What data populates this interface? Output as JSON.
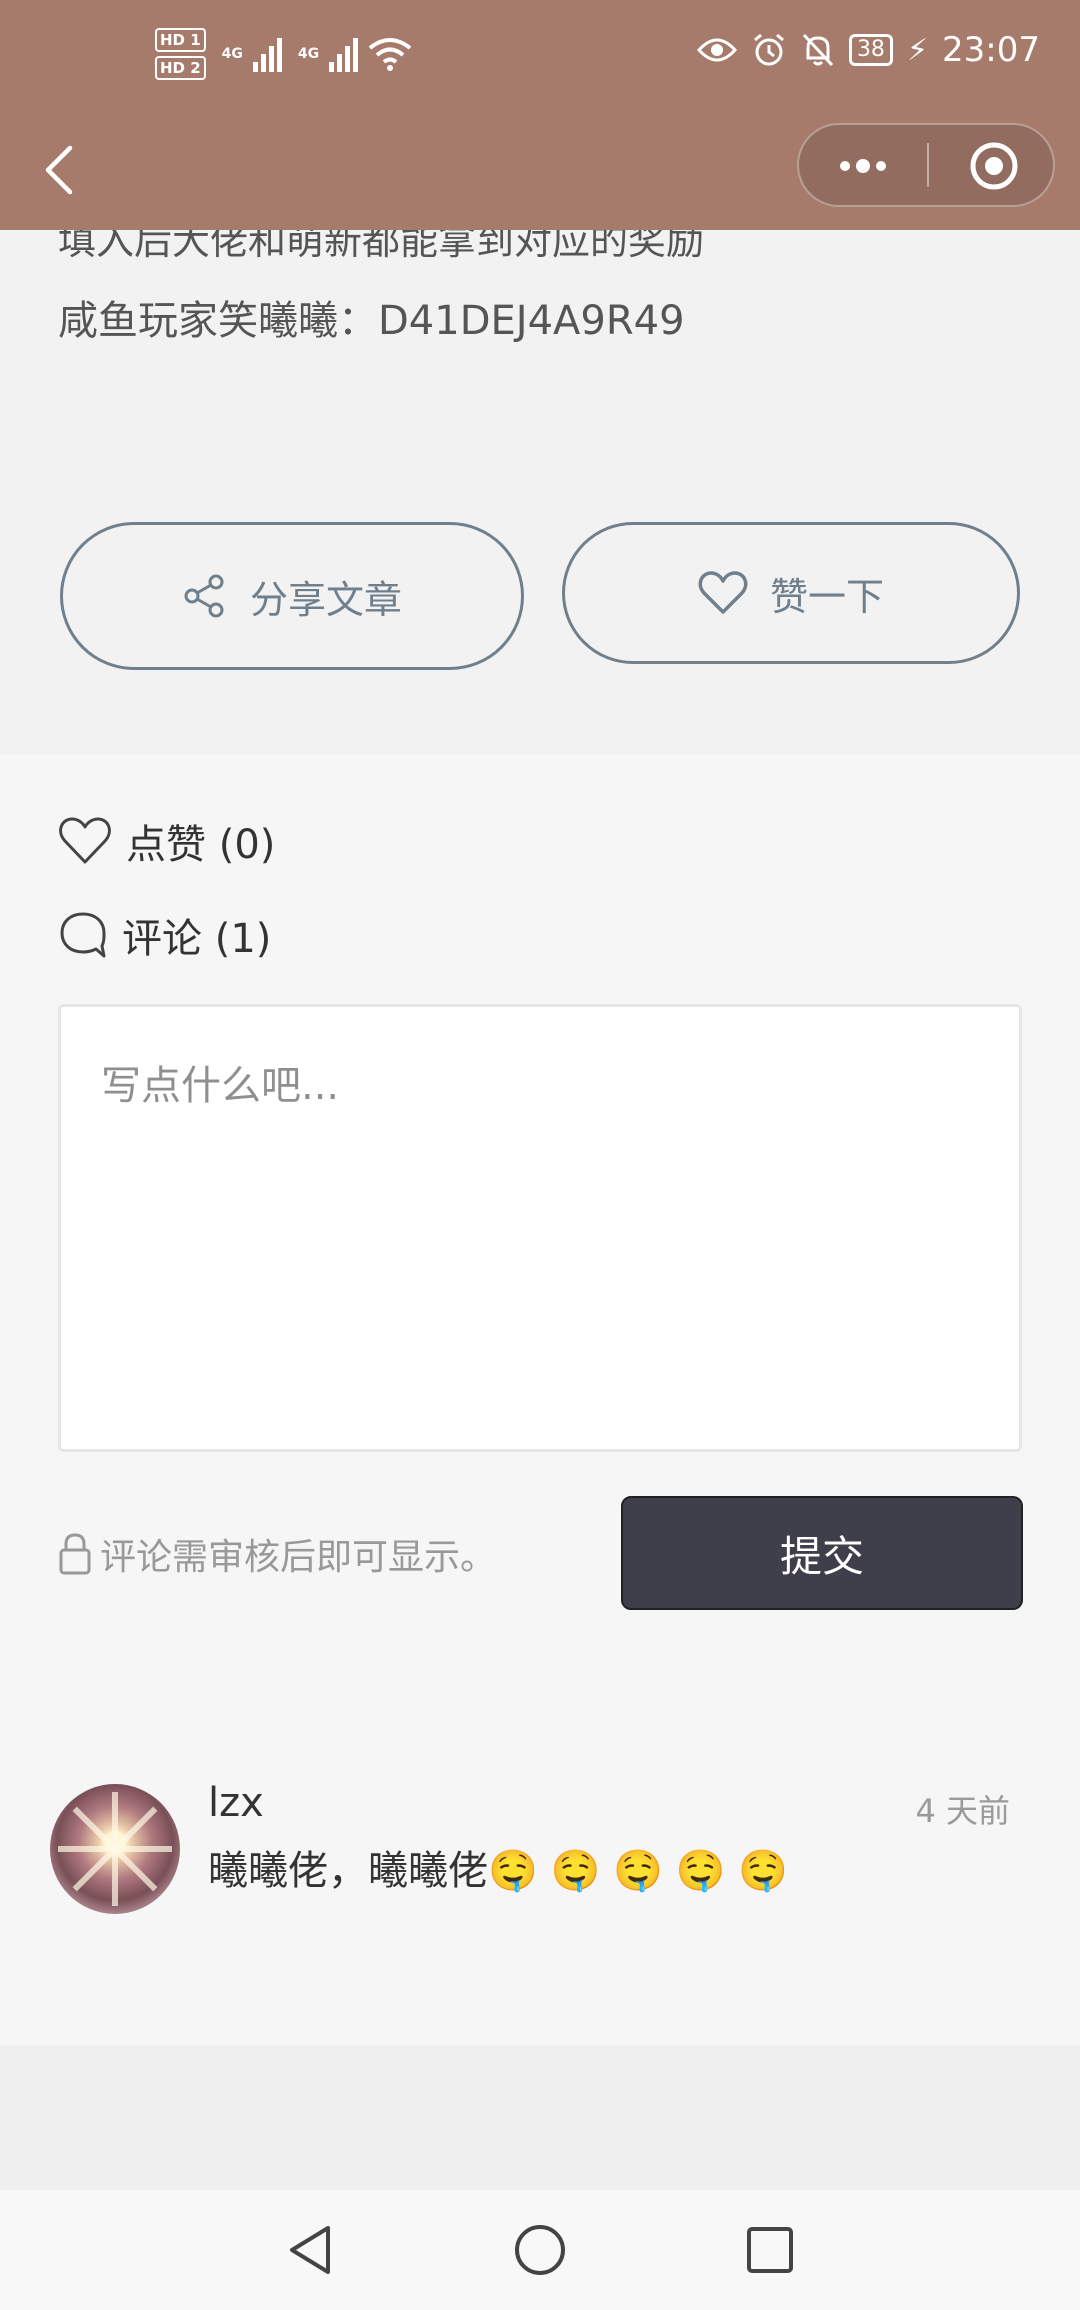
{
  "status_bar": {
    "hd1": "HD 1",
    "hd2": "HD 2",
    "net1": "4G",
    "net2": "4G",
    "battery": "38",
    "time": "23:07"
  },
  "article": {
    "line1": "填入后大佬和萌新都能拿到对应的奖励",
    "line2": "咸鱼玩家笑曦曦：D41DEJ4A9R49"
  },
  "actions": {
    "share_label": "分享文章",
    "like_label": "赞一下"
  },
  "stats": {
    "likes_label": "点赞 (0)",
    "comments_label": "评论 (1)"
  },
  "comment_form": {
    "placeholder": "写点什么吧...",
    "notice": "评论需审核后即可显示。",
    "submit_label": "提交"
  },
  "comments": [
    {
      "author": "lzx",
      "time": "4 天前",
      "text": "曦曦佬，曦曦佬🤤 🤤 🤤 🤤 🤤"
    }
  ],
  "icons": {
    "back": "back-chevron-icon",
    "more": "more-dots-icon",
    "close": "miniprogram-close-icon",
    "share": "share-icon",
    "heart": "heart-icon",
    "comment": "comment-bubble-icon",
    "lock": "lock-icon"
  },
  "colors": {
    "header": "#a77b6b",
    "accent_outline": "#6f7f8c",
    "submit_bg": "#3f3f4b"
  }
}
